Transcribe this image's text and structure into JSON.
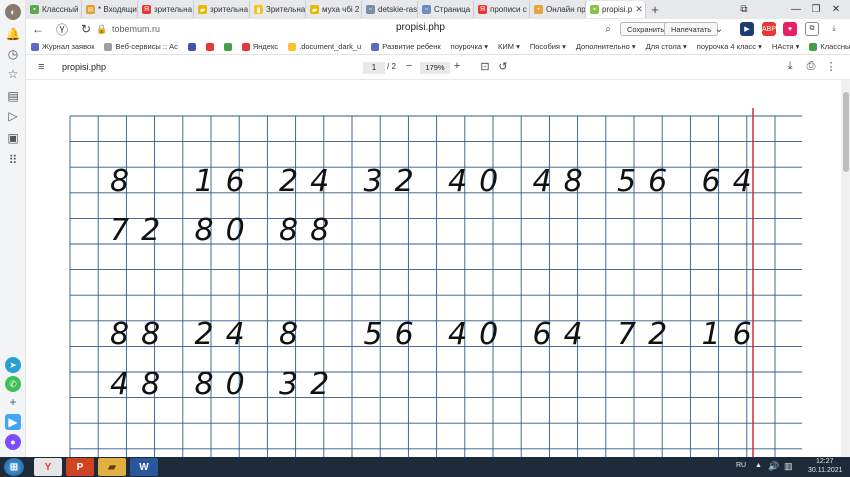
{
  "tabs": [
    {
      "label": "Классный",
      "icon": "classroom-icon",
      "color": "#5aa84a"
    },
    {
      "label": "* Входящи",
      "icon": "mail-icon",
      "color": "#e0a030"
    },
    {
      "label": "зрительна",
      "icon": "yandex-icon",
      "color": "#e53935"
    },
    {
      "label": "зрительна",
      "icon": "folder-icon",
      "color": "#e6b800"
    },
    {
      "label": "Зрительна",
      "icon": "doc-icon",
      "color": "#f5c518"
    },
    {
      "label": "муха чбі 2",
      "icon": "folder-icon",
      "color": "#e6b800"
    },
    {
      "label": "detskie-ras",
      "icon": "page-icon",
      "color": "#7a8ea8"
    },
    {
      "label": "Страница",
      "icon": "page-icon",
      "color": "#6c8ebf"
    },
    {
      "label": "прописи с",
      "icon": "yandex-icon",
      "color": "#e53935"
    },
    {
      "label": "Онлайн пр",
      "icon": "site-icon",
      "color": "#e8a23a"
    },
    {
      "label": "propisi.p",
      "icon": "site-icon",
      "color": "#8bc34a",
      "active": true
    }
  ],
  "address": {
    "domain": "tobemum.ru",
    "title": "propisi.php",
    "save_label": "Сохранить",
    "print_label": "Напечатать"
  },
  "bookmarks": [
    {
      "label": "Журнал заявок",
      "color": "#5c6bc0"
    },
    {
      "label": "Веб-сервисы :: Ас",
      "color": "#9e9e9e"
    },
    {
      "label": "",
      "color": "#3f51b5"
    },
    {
      "label": "",
      "color": "#e53935"
    },
    {
      "label": "",
      "color": "#43a047"
    },
    {
      "label": "Яндекс",
      "color": "#e53935"
    },
    {
      "label": ".document_dark_u",
      "color": "#fbc02d"
    },
    {
      "label": "Развитие ребенк",
      "color": "#5c6bc0"
    },
    {
      "label": "поурочка ▾",
      "color": ""
    },
    {
      "label": "КИМ ▾",
      "color": ""
    },
    {
      "label": "Пособия ▾",
      "color": ""
    },
    {
      "label": "Дополнительно ▾",
      "color": ""
    },
    {
      "label": "Для стола ▾",
      "color": ""
    },
    {
      "label": "поурочка 4 класс ▾",
      "color": ""
    },
    {
      "label": "НАстя ▾",
      "color": ""
    },
    {
      "label": "Классный",
      "color": "#43a047"
    }
  ],
  "pdf_toolbar": {
    "filename": "propisi.php",
    "page_current": "1",
    "page_total": "/ 2",
    "zoom": "179%"
  },
  "worksheet": {
    "row1": [
      "8",
      "16",
      "24",
      "32",
      "40",
      "48",
      "56",
      "64"
    ],
    "row2": [
      "72",
      "80",
      "88"
    ],
    "row3": [
      "88",
      "24",
      "8",
      "56",
      "40",
      "64",
      "72",
      "16"
    ],
    "row4": [
      "48",
      "80",
      "32"
    ]
  },
  "taskbar": {
    "lang": "RU",
    "time": "12:27",
    "date": "30.11.2021"
  },
  "colors": {
    "grid_line": "#2f5a8c",
    "margin_line": "#d32f2f",
    "digit": "#111111"
  }
}
